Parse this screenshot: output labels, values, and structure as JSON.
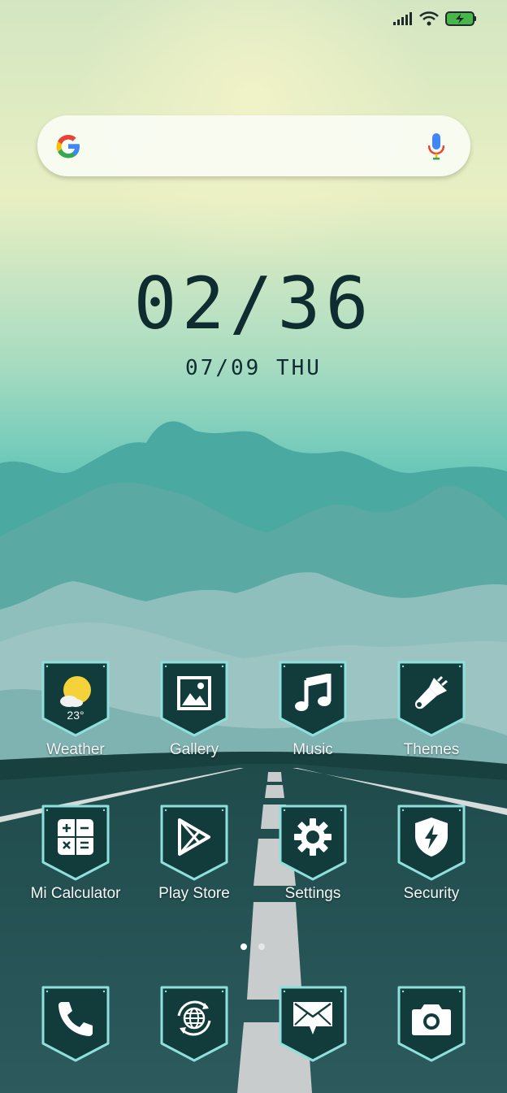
{
  "status_bar": {
    "icons": [
      "signal-icon",
      "wifi-icon",
      "battery-charging-icon"
    ]
  },
  "search": {
    "icons": [
      "google-g-icon",
      "mic-icon"
    ]
  },
  "clock": {
    "time": "02/36",
    "date": "07/09 THU"
  },
  "apps": [
    {
      "label": "Weather",
      "icon": "weather-icon",
      "temp": "23°"
    },
    {
      "label": "Gallery",
      "icon": "gallery-icon"
    },
    {
      "label": "Music",
      "icon": "music-icon"
    },
    {
      "label": "Themes",
      "icon": "brush-icon"
    },
    {
      "label": "Mi Calculator",
      "icon": "calculator-icon"
    },
    {
      "label": "Play Store",
      "icon": "play-store-icon"
    },
    {
      "label": "Settings",
      "icon": "gear-icon"
    },
    {
      "label": "Security",
      "icon": "shield-icon"
    }
  ],
  "dock": [
    {
      "icon": "phone-icon"
    },
    {
      "icon": "browser-icon"
    },
    {
      "icon": "messages-icon"
    },
    {
      "icon": "camera-icon"
    }
  ],
  "page_indicator": {
    "pages": 2,
    "current": 1
  },
  "colors": {
    "icon_bg": "#123c3c",
    "icon_border": "#8fe0dc",
    "clock_text": "#0f2c30"
  }
}
